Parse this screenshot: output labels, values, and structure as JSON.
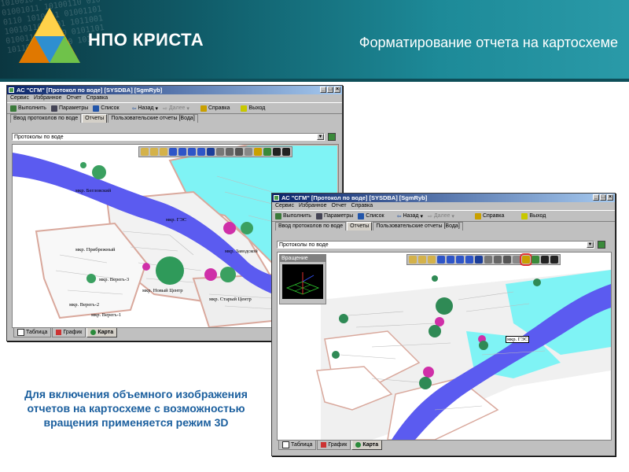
{
  "header": {
    "company": "НПО КРИСТА",
    "title": "Форматирование отчета на картосхеме",
    "bits": "1010010 0101101 1100101\n01001011 10100110 010\n0110 1010011 01001101\n10010110 0101 1011001\n0100110 10110 0101101\n101101 0100110 101"
  },
  "window1": {
    "title": "АС \"СГМ\" [Протокол по воде] [SYSDBA] [SgmRyb]",
    "menu": [
      "Сервис",
      "Избранное",
      "Отчет",
      "Справка"
    ],
    "toolbar": {
      "run": "Выполнить",
      "params": "Параметры",
      "list": "Список",
      "back": "Назад",
      "forward": "Далее",
      "help": "Справка",
      "exit": "Выход"
    },
    "tabs": [
      "Ввод протоколов по воде",
      "Отчеты",
      "Пользовательские отчеты [Вода]"
    ],
    "report_combo": "Протоколы по воде",
    "bottom_tabs": [
      "Таблица",
      "График",
      "Карта"
    ],
    "map_labels": {
      "a": "мкр. Бегловский",
      "b": "мкр. ГЭС",
      "c": "мкр. Прибрежный",
      "d": "мкр. Заводской",
      "e": "мкр. Верегь-3",
      "f": "мкр. Новый Центр",
      "g": "мкр. Старый Центр",
      "h": "мкр. Верегь-2",
      "i": "мкр. Верегь-1"
    }
  },
  "window2": {
    "title": "АС \"СГМ\" [Протокол по воде] [SYSDBA] [SgmRyb]",
    "menu": [
      "Сервис",
      "Избранное",
      "Отчет",
      "Справка"
    ],
    "toolbar": {
      "run": "Выполнить",
      "params": "Параметры",
      "list": "Список",
      "back": "Назад",
      "forward": "Далее",
      "help": "Справка",
      "exit": "Выход"
    },
    "tabs": [
      "Ввод протоколов по воде",
      "Отчеты",
      "Пользовательские отчеты [Вода]"
    ],
    "report_combo": "Протоколы по воде",
    "rotation_label": "Вращение",
    "map_label": "мкр. ГЭС",
    "bottom_tabs": [
      "Таблица",
      "График",
      "Карта"
    ]
  },
  "caption": "Для включения объемного изображения отчетов на картосхеме с возможностью вращения применяется режим 3D",
  "colors": {
    "accent": "#1b5f9e",
    "river": "#5b5bf0",
    "land": "#7ff3f5",
    "highlight": "#e03030"
  }
}
